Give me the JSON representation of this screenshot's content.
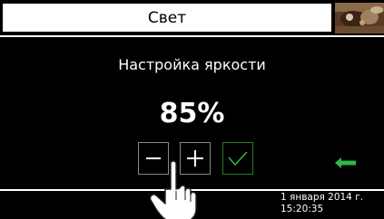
{
  "header": {
    "title": "Свет",
    "thumbnail_icon": "camera-preview"
  },
  "panel": {
    "title": "Настройка яркости",
    "brightness_value": "85%"
  },
  "controls": {
    "minus_icon": "minus-icon",
    "plus_icon": "plus-icon",
    "confirm_icon": "check-icon",
    "back_icon": "arrow-left-icon"
  },
  "footer": {
    "date": "1 января 2014 г.",
    "time": "15:20:35"
  },
  "colors": {
    "accent_green": "#2fb84a",
    "background": "#000000",
    "foreground": "#ffffff"
  }
}
